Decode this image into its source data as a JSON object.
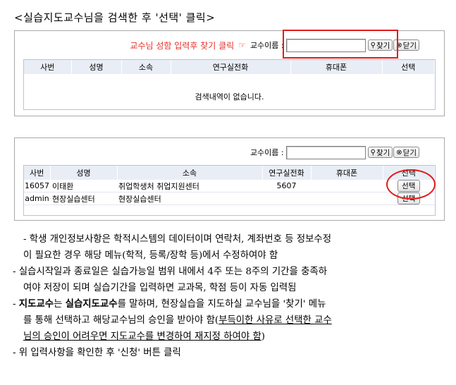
{
  "title": "<실습지도교수님을 검색한 후 '선택' 클릭>",
  "panel1": {
    "hint": "교수님 성함 입력후 찾기 클릭",
    "hint_icon": "☞",
    "label": "교수이름 :",
    "find_label": "찾기",
    "close_label": "닫기",
    "columns": [
      "사번",
      "성명",
      "소속",
      "연구실전화",
      "휴대폰",
      "선택"
    ],
    "empty_message": "검색내역이 없습니다."
  },
  "panel2": {
    "label": "교수이름 :",
    "find_label": "찾기",
    "close_label": "닫기",
    "columns": [
      "사번",
      "성명",
      "소속",
      "연구실전화",
      "휴대폰",
      "선택"
    ],
    "rows": [
      {
        "id": "16057",
        "name": "이태환",
        "dept": "취업학생처 취업지원센터",
        "phone": "5607",
        "mobile": "",
        "select": "선택"
      },
      {
        "id": "admin",
        "name": "현장실습센터",
        "dept": "현장실습센터",
        "phone": "",
        "mobile": "",
        "select": "선택"
      }
    ]
  },
  "notes": {
    "n1a": "- 학생 개인정보사항은 학적시스템의 데이터이며 연락처, 계좌번호 등 정보수정",
    "n1b": "이 필요한 경우 해당 메뉴(학적, 등록/장학 등)에서 수정하여야 함",
    "n2a": "- 실습시작일과 종료일은 실습가능일 범위 내에서 4주 또는 8주의 기간을 충족하",
    "n2b": "여야 저장이 되며 실습기간을 입력하면 교과목, 학점 등이 자동 입력됨",
    "n3_dash": "- ",
    "n3_bold1": "지도교수",
    "n3_mid1": "는 ",
    "n3_bold2": "실습지도교수",
    "n3_mid2": "를 말하며, 현장실습을 지도하실 교수님을 '찾기' 메뉴",
    "n3b_plain": "를 통해 선택하고 해당교수님의 승인을 받아야 함(",
    "n3b_ul": "부득이한 사유로 선택한 교수",
    "n3c_ul": "님의 승인이 어려우면 지도교수를 변경하여 재지정 하여야 함",
    "n3c_end": ")",
    "n4": "- 위 입력사항을 확인한 후 '신청' 버튼 클릭"
  }
}
